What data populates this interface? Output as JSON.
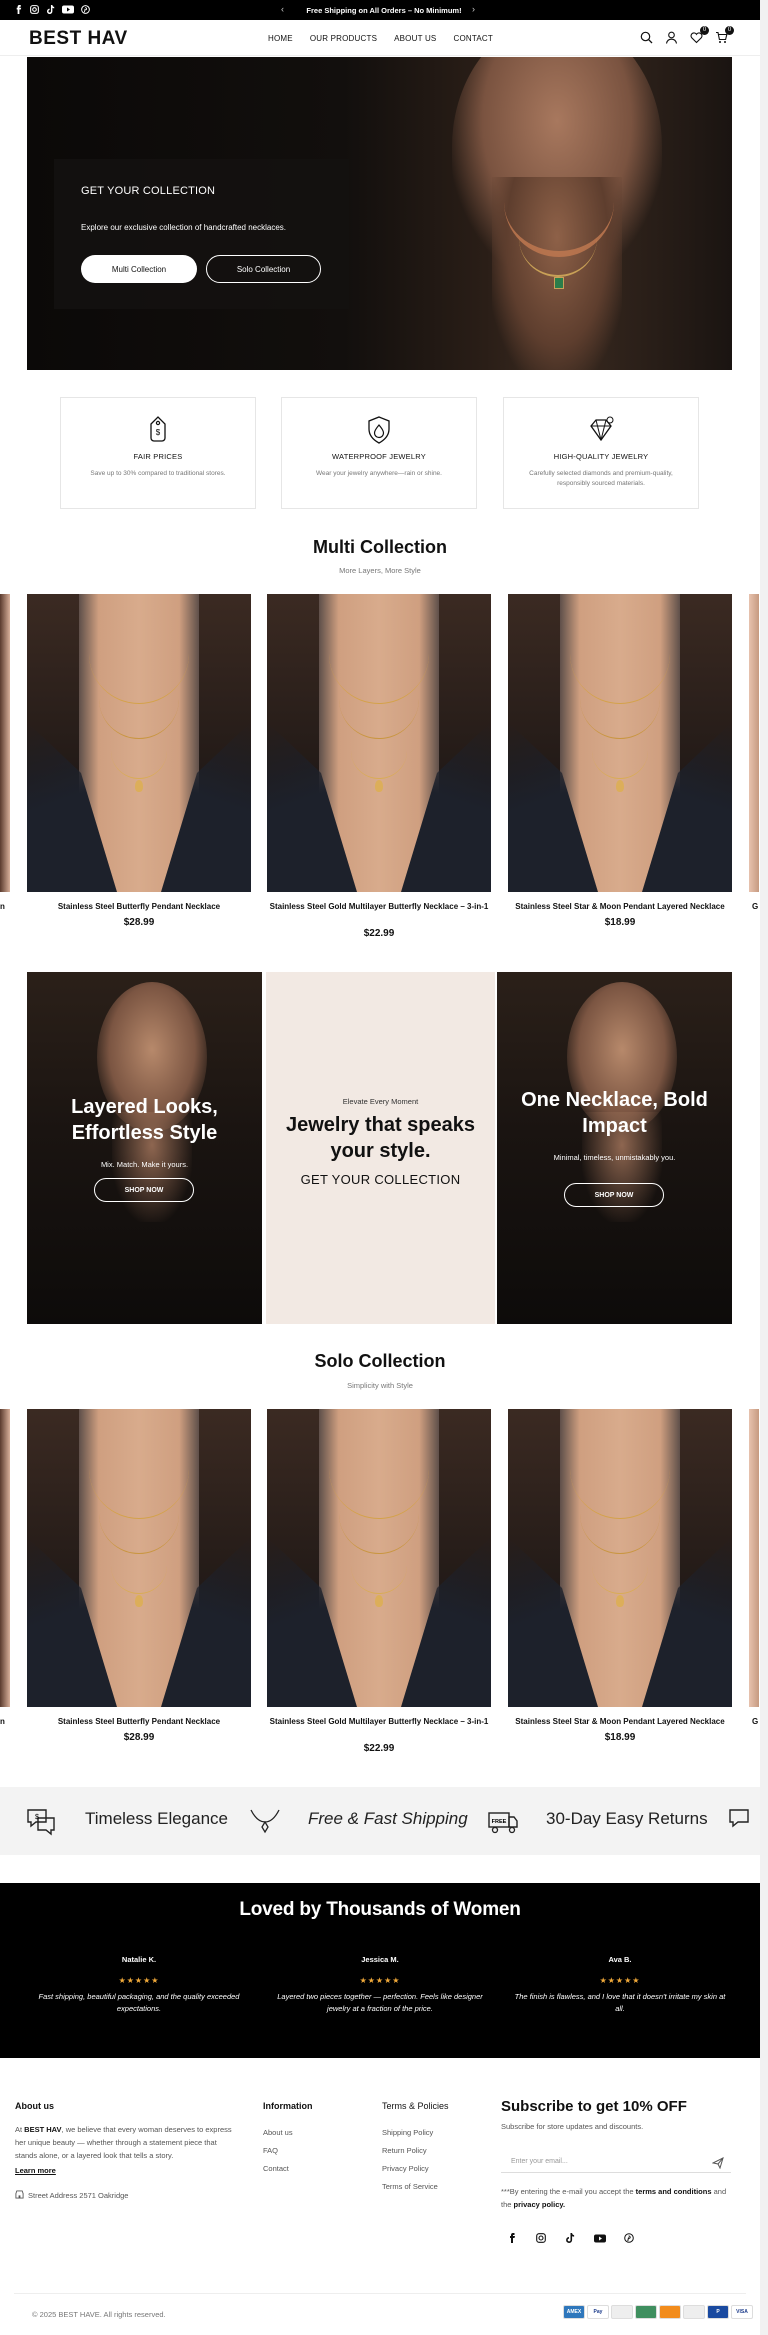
{
  "announcement": {
    "message": "Free Shipping on All Orders – No Minimum!",
    "prev": "‹",
    "next": "›"
  },
  "header": {
    "logo": "BEST HAV",
    "nav": [
      "HOME",
      "OUR PRODUCTS",
      "ABOUT US",
      "CONTACT"
    ],
    "wishlist_count": "0",
    "cart_count": "0"
  },
  "hero": {
    "title": "GET YOUR COLLECTION",
    "subtitle": "Explore our exclusive collection of handcrafted necklaces.",
    "button_primary": "Multi Collection",
    "button_secondary": "Solo Collection"
  },
  "features": [
    {
      "title": "FAIR PRICES",
      "text": "Save up to 30% compared to traditional stores.",
      "icon": "price-tag-icon"
    },
    {
      "title": "WATERPROOF JEWELRY",
      "text": "Wear your jewelry anywhere—rain or shine.",
      "icon": "water-drop-shield-icon"
    },
    {
      "title": "HIGH-QUALITY JEWELRY",
      "text": "Carefully selected diamonds and premium-quality, responsibly sourced materials.",
      "icon": "diamond-icon"
    }
  ],
  "multi": {
    "title": "Multi Collection",
    "subtitle": "More Layers, More Style",
    "products": [
      {
        "name": "Stainless Steel Butterfly Pendant Necklace",
        "price": "$28.99"
      },
      {
        "name": "Stainless Steel Gold Multilayer Butterfly Necklace – 3-in-1",
        "price": "$22.99"
      },
      {
        "name": "Stainless Steel Star & Moon Pendant Layered Necklace",
        "price": "$18.99"
      }
    ],
    "cut_left": "n",
    "cut_right": "G"
  },
  "banners": {
    "left": {
      "title_line1": "Layered Looks,",
      "title_line2": "Effortless Style",
      "sub": "Mix. Match. Make it yours.",
      "button": "SHOP NOW"
    },
    "middle": {
      "small": "Elevate Every Moment",
      "line1": "Jewelry that speaks",
      "line2": "your style.",
      "cta": "GET YOUR COLLECTION"
    },
    "right": {
      "title_line1": "One Necklace, Bold",
      "title_line2": "Impact",
      "sub": "Minimal, timeless, unmistakably you.",
      "button": "SHOP NOW"
    }
  },
  "solo": {
    "title": "Solo Collection",
    "subtitle": "Simplicity with Style",
    "products": [
      {
        "name": "Stainless Steel Butterfly Pendant Necklace",
        "price": "$28.99"
      },
      {
        "name": "Stainless Steel Gold Multilayer Butterfly Necklace – 3-in-1",
        "price": "$22.99"
      },
      {
        "name": "Stainless Steel Star & Moon Pendant Layered Necklace",
        "price": "$18.99"
      }
    ],
    "cut_left": "n",
    "cut_right": "G"
  },
  "strip": {
    "items": [
      "Timeless Elegance",
      "Free & Fast Shipping",
      "30-Day Easy Returns"
    ],
    "free_badge": "FREE"
  },
  "testimonials": {
    "title": "Loved by Thousands of Women",
    "stars": "★★★★★",
    "items": [
      {
        "name": "Natalie K.",
        "quote": "Fast shipping, beautiful packaging, and the quality exceeded expectations."
      },
      {
        "name": "Jessica M.",
        "quote": "Layered two pieces together — perfection. Feels like designer jewelry at a fraction of the price."
      },
      {
        "name": "Ava B.",
        "quote": "The finish is flawless, and I love that it doesn't irritate my skin at all."
      }
    ]
  },
  "footer": {
    "about_title": "About us",
    "about_prefix": "At ",
    "about_brand": "BEST HAV",
    "about_text": ", we believe that every woman deserves to express her unique beauty — whether through a statement piece that stands alone, or a layered look that tells a story.",
    "learn_more": "Learn more",
    "address": "Street Address 2571 Oakridge",
    "info_title": "Information",
    "info_links": [
      "About us",
      "FAQ",
      "Contact"
    ],
    "terms_title": "Terms & Policies",
    "terms_links": [
      "Shipping Policy",
      "Return Policy",
      "Privacy Policy",
      "Terms of Service"
    ],
    "subscribe_title": "Subscribe to get 10% OFF",
    "subscribe_sub": "Subscribe for store updates and discounts.",
    "email_placeholder": "Enter your email...",
    "consent_prefix": "***By entering the e-mail you accept the ",
    "consent_terms": "terms and conditions",
    "consent_mid": " and the ",
    "consent_privacy": "privacy policy.",
    "copyright": "© 2025 BEST HAVE. All rights reserved.",
    "payments": [
      {
        "label": "AMEX",
        "color": "#2e77bc"
      },
      {
        "label": "Pay",
        "color": "#ffffff"
      },
      {
        "label": "",
        "color": "#eeeeee"
      },
      {
        "label": "",
        "color": "#3f8f5f"
      },
      {
        "label": "",
        "color": "#f28c1c"
      },
      {
        "label": "",
        "color": "#eeeeee"
      },
      {
        "label": "P",
        "color": "#1a4aa0"
      },
      {
        "label": "VISA",
        "color": "#ffffff"
      }
    ]
  }
}
